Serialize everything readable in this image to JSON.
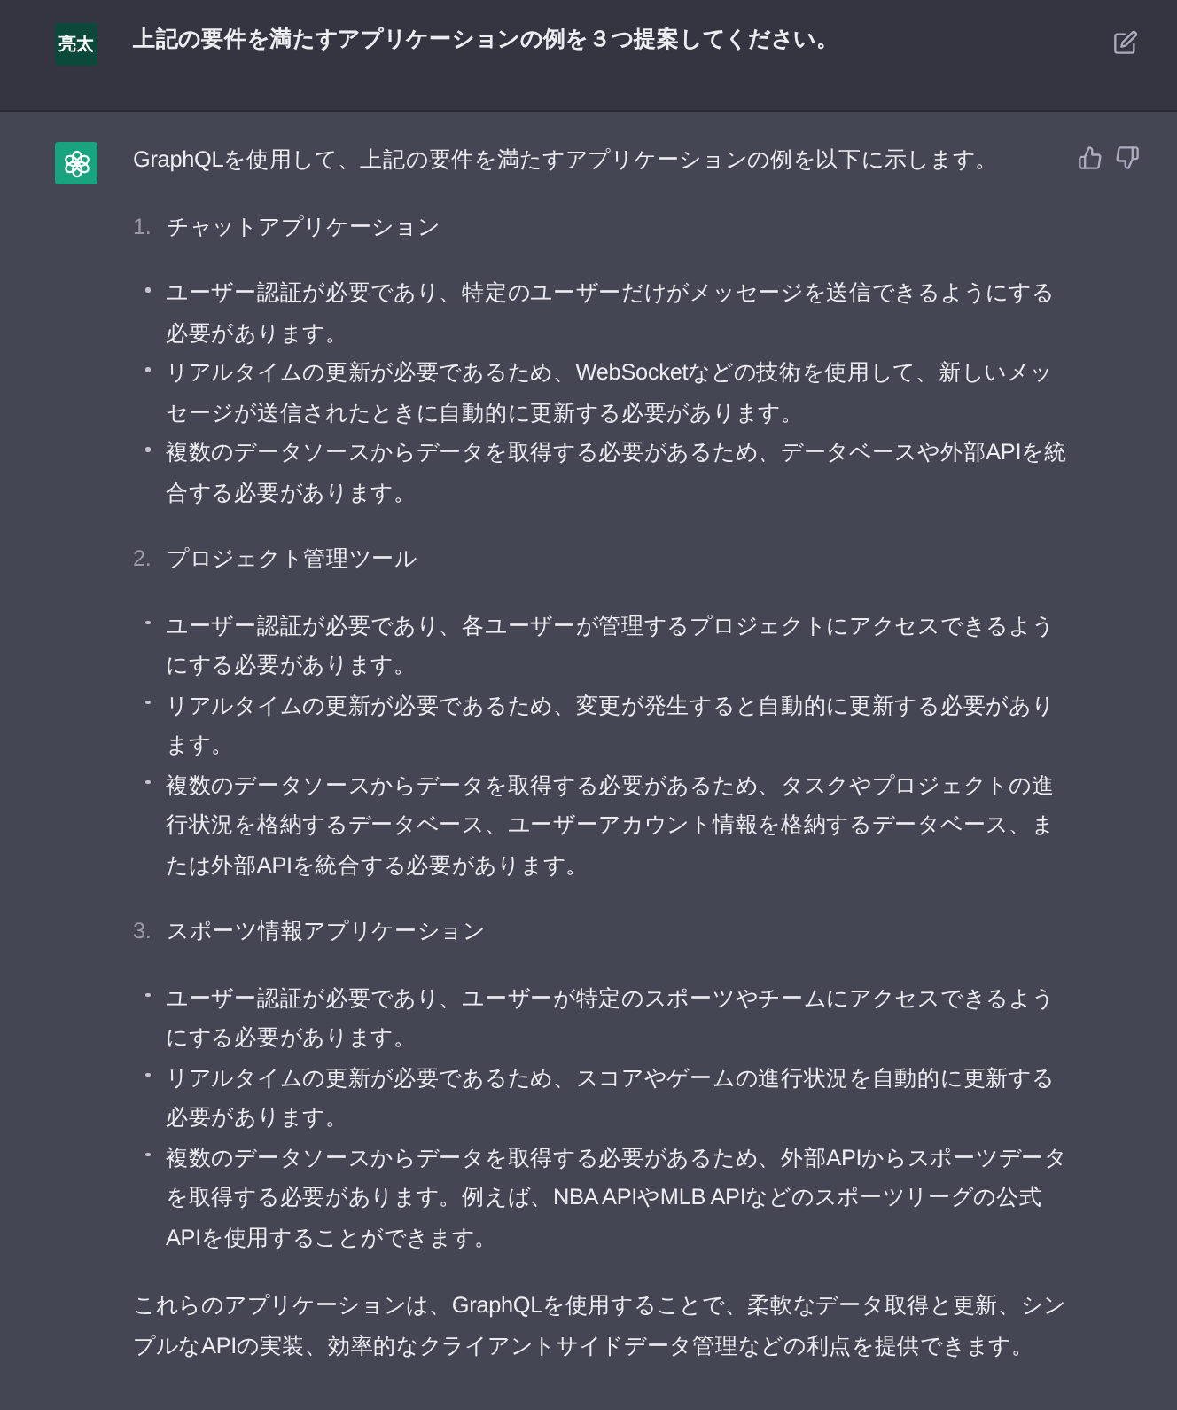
{
  "messages": [
    {
      "kind": "user",
      "avatar_text": "亮太",
      "text": "上記の要件を満たすアプリケーションの例を３つ提案してください。"
    },
    {
      "kind": "assistant",
      "intro": "GraphQLを使用して、上記の要件を満たすアプリケーションの例を以下に示します。",
      "sections": [
        {
          "number": "1.",
          "title": "チャットアプリケーション",
          "bullets": [
            "ユーザー認証が必要であり、特定のユーザーだけがメッセージを送信できるようにする必要があります。",
            "リアルタイムの更新が必要であるため、WebSocketなどの技術を使用して、新しいメッセージが送信されたときに自動的に更新する必要があります。",
            "複数のデータソースからデータを取得する必要があるため、データベースや外部APIを統合する必要があります。"
          ]
        },
        {
          "number": "2.",
          "title": "プロジェクト管理ツール",
          "bullets": [
            "ユーザー認証が必要であり、各ユーザーが管理するプロジェクトにアクセスできるようにする必要があります。",
            "リアルタイムの更新が必要であるため、変更が発生すると自動的に更新する必要があります。",
            "複数のデータソースからデータを取得する必要があるため、タスクやプロジェクトの進行状況を格納するデータベース、ユーザーアカウント情報を格納するデータベース、または外部APIを統合する必要があります。"
          ]
        },
        {
          "number": "3.",
          "title": "スポーツ情報アプリケーション",
          "bullets": [
            "ユーザー認証が必要であり、ユーザーが特定のスポーツやチームにアクセスできるようにする必要があります。",
            "リアルタイムの更新が必要であるため、スコアやゲームの進行状況を自動的に更新する必要があります。",
            "複数のデータソースからデータを取得する必要があるため、外部APIからスポーツデータを取得する必要があります。例えば、NBA APIやMLB APIなどのスポーツリーグの公式APIを使用することができます。"
          ]
        }
      ],
      "conclusion": "これらのアプリケーションは、GraphQLを使用することで、柔軟なデータ取得と更新、シンプルなAPIの実装、効率的なクライアントサイドデータ管理などの利点を提供できます。"
    }
  ]
}
